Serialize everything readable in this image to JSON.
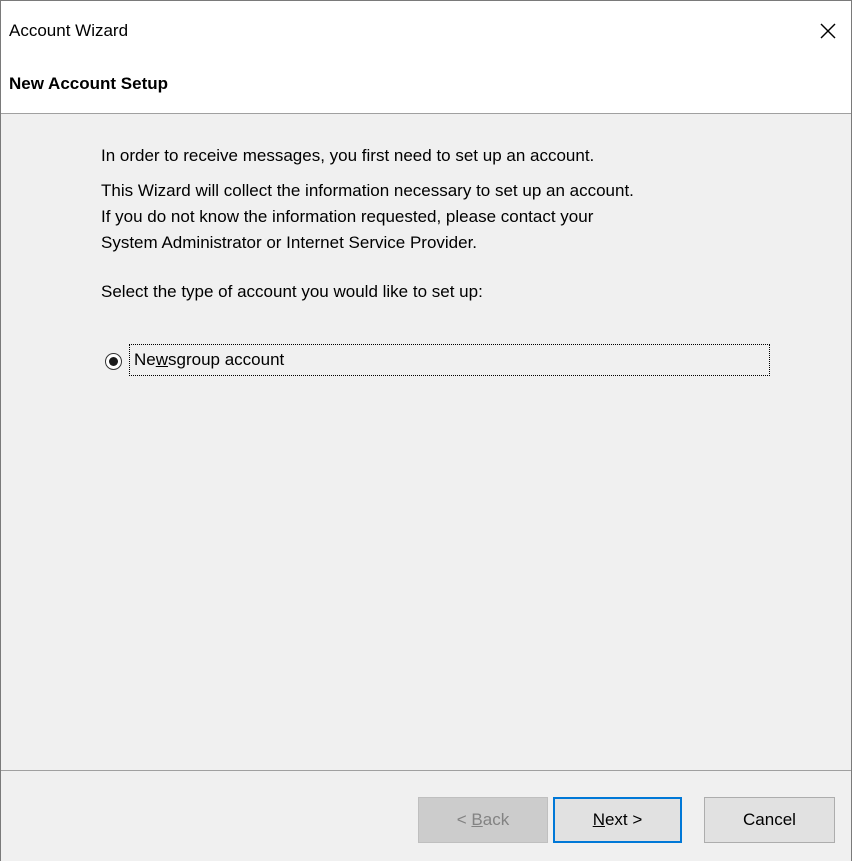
{
  "window": {
    "title": "Account Wizard",
    "close_label": "close"
  },
  "header": {
    "title": "New Account Setup"
  },
  "content": {
    "paragraph1": "In order to receive messages, you first need to set up an account.",
    "paragraph2_line1": "This Wizard will collect the information necessary to set up an account.",
    "paragraph2_line2": "If you do not know the information requested, please contact your",
    "paragraph2_line3": "System Administrator or Internet Service Provider.",
    "prompt": "Select the type of account you would like to set up:",
    "account_options": [
      {
        "label_pre": "Ne",
        "label_accel": "w",
        "label_post": "sgroup account",
        "selected": true
      }
    ]
  },
  "footer": {
    "back": {
      "pre": "< ",
      "accel": "B",
      "post": "ack",
      "enabled": false
    },
    "next": {
      "pre": "",
      "accel": "N",
      "post": "ext >",
      "enabled": true,
      "default": true
    },
    "cancel": {
      "label": "Cancel",
      "enabled": true
    }
  },
  "colors": {
    "window_bg": "#f0f0f0",
    "header_bg": "#ffffff",
    "default_button_border": "#0078d7",
    "disabled_text": "#838383"
  },
  "icons": {
    "close": "close-icon",
    "radio": "radio-selected-icon"
  }
}
